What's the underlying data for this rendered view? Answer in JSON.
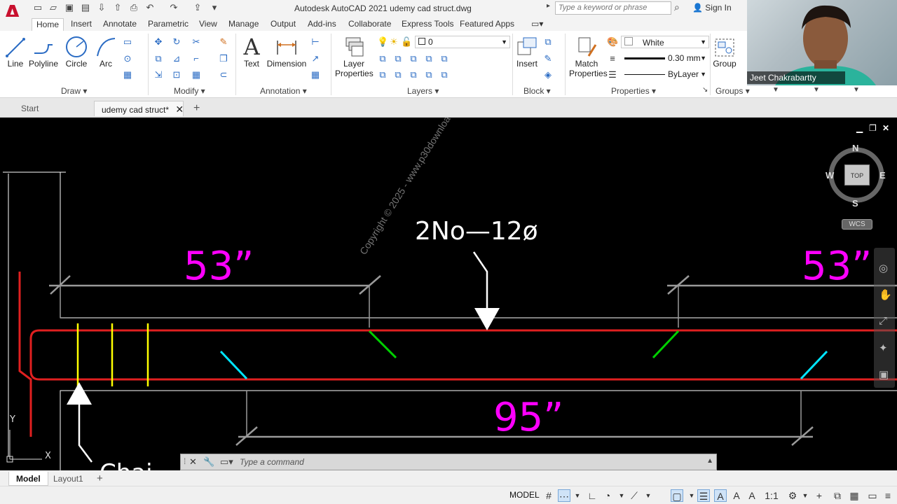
{
  "titlebar": {
    "app_logo": "A",
    "title": "Autodesk AutoCAD 2021    udemy cad struct.dwg",
    "search_placeholder": "Type a keyword or phrase",
    "sign_in": "Sign In"
  },
  "ribbon_tabs": [
    "Home",
    "Insert",
    "Annotate",
    "Parametric",
    "View",
    "Manage",
    "Output",
    "Add-ins",
    "Collaborate",
    "Express Tools",
    "Featured Apps"
  ],
  "ribbon": {
    "draw": {
      "line": "Line",
      "polyline": "Polyline",
      "circle": "Circle",
      "arc": "Arc",
      "title": "Draw"
    },
    "modify": {
      "title": "Modify"
    },
    "annotation": {
      "text": "Text",
      "dimension": "Dimension",
      "title": "Annotation"
    },
    "layers": {
      "layer_properties_1": "Layer",
      "layer_properties_2": "Properties",
      "current_layer": "0",
      "title": "Layers"
    },
    "block": {
      "insert": "Insert",
      "title": "Block"
    },
    "properties": {
      "match_1": "Match",
      "match_2": "Properties",
      "color": "White",
      "lineweight": "0.30 mm",
      "linetype": "ByLayer",
      "title": "Properties"
    },
    "groups": {
      "group": "Group",
      "title": "Groups"
    }
  },
  "doc_tabs": {
    "start": "Start",
    "active": "udemy cad struct*"
  },
  "drawing": {
    "label_rebar": "2No—12ø",
    "dim_left": "53”",
    "dim_right": "53”",
    "dim_bottom": "95”",
    "watermark": "Copyright © 2025 - www.p30download.com",
    "bottom_text": "Chai",
    "ucs_y": "Y",
    "ucs_x": "X"
  },
  "viewcube": {
    "top": "TOP",
    "n": "N",
    "s": "S",
    "e": "E",
    "w": "W",
    "wcs": "WCS"
  },
  "command": {
    "placeholder": "Type a command"
  },
  "layout_tabs": [
    "Model",
    "Layout1"
  ],
  "status": {
    "model": "MODEL",
    "scale": "1:1"
  },
  "webcam": {
    "name": "Jeet Chakrabartty"
  },
  "colors": {
    "autocad_red": "#c8102e",
    "rebar_red": "#e02020",
    "magenta": "#ff00ff",
    "yellow": "#ffff00",
    "cyan": "#00e5ff",
    "green": "#00d000"
  }
}
